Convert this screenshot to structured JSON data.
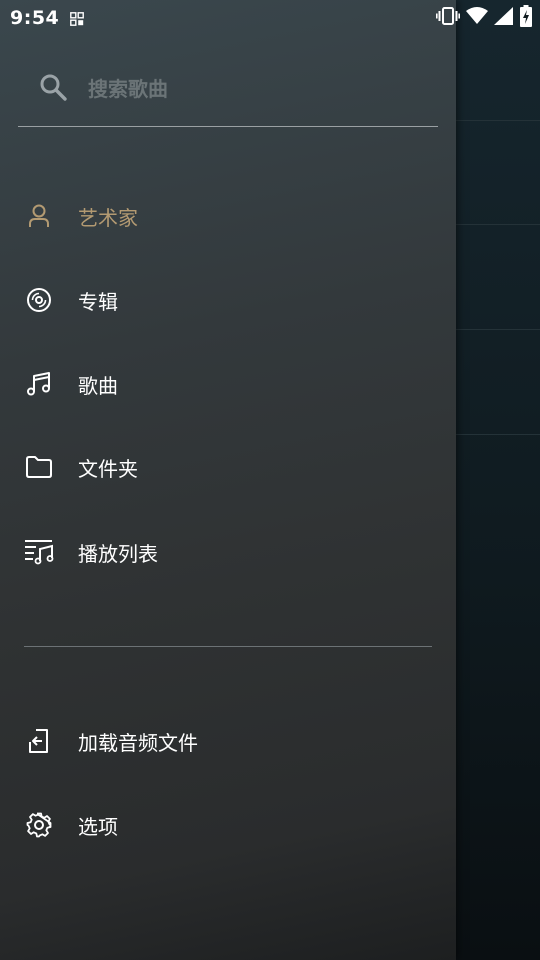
{
  "status_bar": {
    "time": "9:54"
  },
  "search": {
    "placeholder": "搜索歌曲",
    "value": ""
  },
  "nav": {
    "items": [
      {
        "label": "艺术家",
        "icon": "person-icon",
        "active": true
      },
      {
        "label": "专辑",
        "icon": "album-disc-icon",
        "active": false
      },
      {
        "label": "歌曲",
        "icon": "music-note-icon",
        "active": false
      },
      {
        "label": "文件夹",
        "icon": "folder-icon",
        "active": false
      },
      {
        "label": "播放列表",
        "icon": "playlist-icon",
        "active": false
      }
    ],
    "secondary": [
      {
        "label": "加载音频文件",
        "icon": "import-icon"
      },
      {
        "label": "选项",
        "icon": "gear-icon"
      }
    ]
  },
  "colors": {
    "active_accent": "#b39a72",
    "text": "#ffffff",
    "placeholder": "#6b7477"
  }
}
